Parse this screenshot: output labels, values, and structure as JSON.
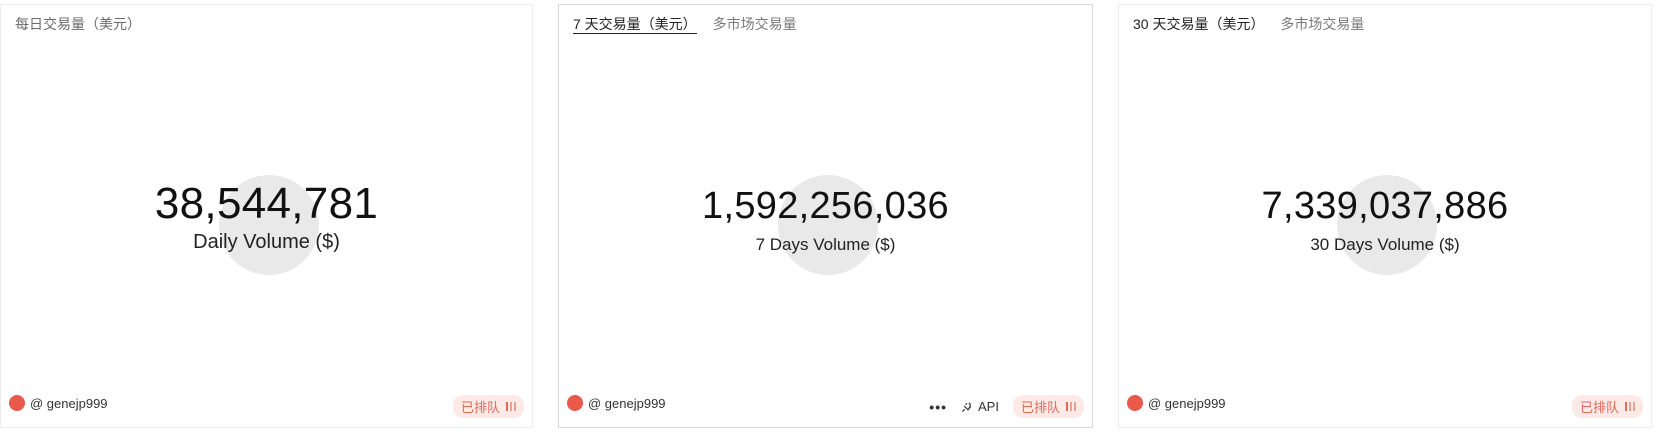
{
  "cards": {
    "daily": {
      "header": {
        "title": "每日交易量（美元）"
      },
      "value": "38,544,781",
      "label": "Daily Volume ($)",
      "author": "@ genejp999",
      "status": "已排队"
    },
    "week": {
      "tabs": [
        {
          "label": "7 天交易量（美元）",
          "active": true
        },
        {
          "label": "多市场交易量",
          "active": false
        }
      ],
      "value": "1,592,256,036",
      "label": "7 Days Volume ($)",
      "author": "@ genejp999",
      "more": "•••",
      "api": "API",
      "status": "已排队"
    },
    "month": {
      "tabs": [
        {
          "label": "30 天交易量（美元）",
          "active": true
        },
        {
          "label": "多市场交易量",
          "active": false
        }
      ],
      "value": "7,339,037,886",
      "label": "30 Days Volume ($)",
      "author": "@ genejp999",
      "status": "已排队"
    }
  },
  "colors": {
    "avatar": "#e8594a",
    "status_bg": "#fde9e6",
    "status_text": "#e06a5a",
    "placeholder_circle": "#e9e9e9"
  },
  "icons": {
    "avatar": "user-avatar",
    "plug": "plug-icon",
    "status": "queue-bars-icon",
    "more": "ellipsis-icon"
  }
}
